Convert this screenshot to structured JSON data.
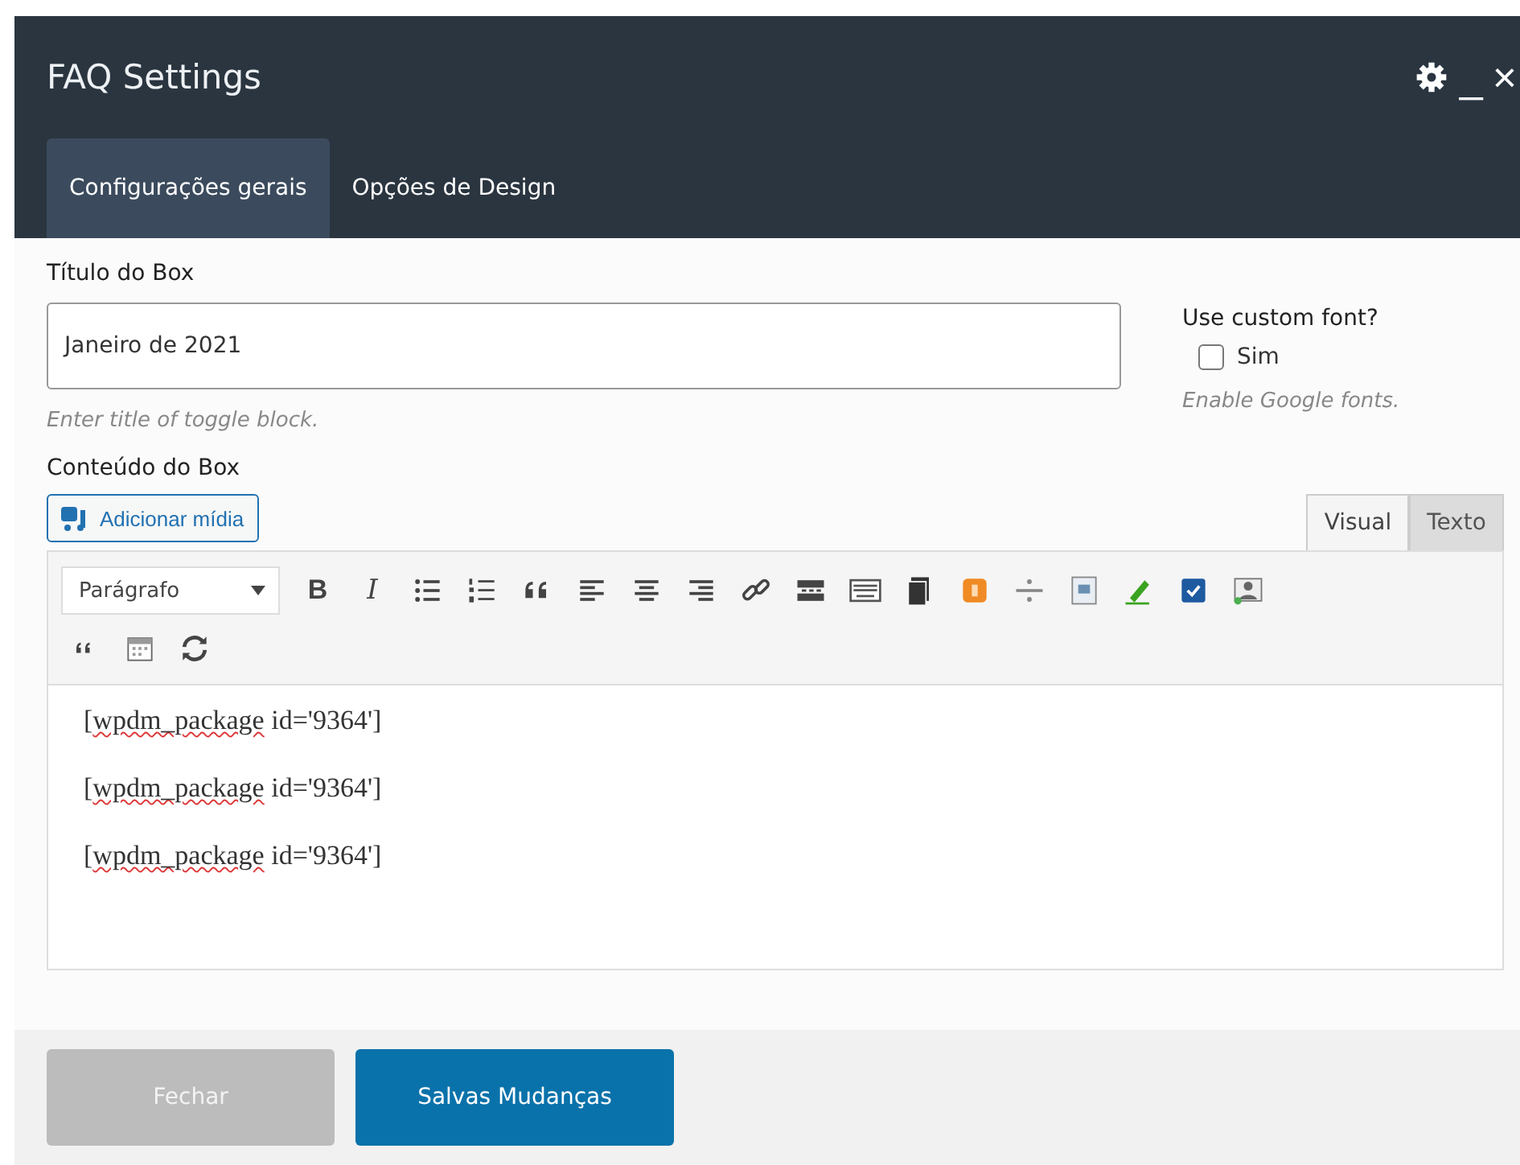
{
  "window": {
    "title": "FAQ Settings",
    "controls": [
      {
        "kind": "settings"
      },
      {
        "kind": "minimize",
        "label": "_"
      },
      {
        "kind": "close",
        "label": "×"
      }
    ]
  },
  "tabs": [
    {
      "label": "Configurações gerais",
      "selected": true
    },
    {
      "label": "Opções de Design",
      "selected": false
    }
  ],
  "title_field": {
    "label": "Título do Box",
    "value": "Janeiro de 2021",
    "help": "Enter title of toggle block."
  },
  "custom_font": {
    "label": "Use custom font?",
    "option": "Sim",
    "checked": false,
    "help": "Enable Google fonts."
  },
  "content": {
    "label": "Conteúdo do Box",
    "media_button": "Adicionar mídia",
    "modes": [
      {
        "label": "Visual",
        "selected": true
      },
      {
        "label": "Texto",
        "selected": false
      }
    ],
    "format": "Parágrafo",
    "toolbar_rows": [
      [
        {
          "kind": "bold",
          "label": "B"
        },
        {
          "kind": "italic",
          "label": "I"
        },
        {
          "kind": "bullets"
        },
        {
          "kind": "numbers"
        },
        {
          "kind": "quote"
        },
        {
          "kind": "align-left"
        },
        {
          "kind": "align-center"
        },
        {
          "kind": "align-right"
        },
        {
          "kind": "link"
        },
        {
          "kind": "more"
        },
        {
          "kind": "keyboard"
        },
        {
          "kind": "pages"
        },
        {
          "kind": "orange"
        },
        {
          "kind": "divider"
        },
        {
          "kind": "textimage"
        },
        {
          "kind": "marker"
        },
        {
          "kind": "check"
        },
        {
          "kind": "person"
        }
      ],
      [
        {
          "kind": "smallquote"
        },
        {
          "kind": "calendar"
        },
        {
          "kind": "refresh"
        }
      ]
    ],
    "paragraphs": [
      {
        "parts": [
          {
            "text": "[",
            "spell_error": false
          },
          {
            "text": "wpdm_package",
            "spell_error": true
          },
          {
            "text": " id='9364']",
            "spell_error": false
          }
        ]
      },
      {
        "parts": [
          {
            "text": "[",
            "spell_error": false
          },
          {
            "text": "wpdm_package",
            "spell_error": true
          },
          {
            "text": " id='9364']",
            "spell_error": false
          }
        ]
      },
      {
        "parts": [
          {
            "text": "[",
            "spell_error": false
          },
          {
            "text": "wpdm_package",
            "spell_error": true
          },
          {
            "text": " id='9364']",
            "spell_error": false
          }
        ]
      }
    ]
  },
  "buttons": [
    {
      "label": "Fechar",
      "kind": "secondary"
    },
    {
      "label": "Salvas Mudanças",
      "kind": "primary"
    }
  ]
}
